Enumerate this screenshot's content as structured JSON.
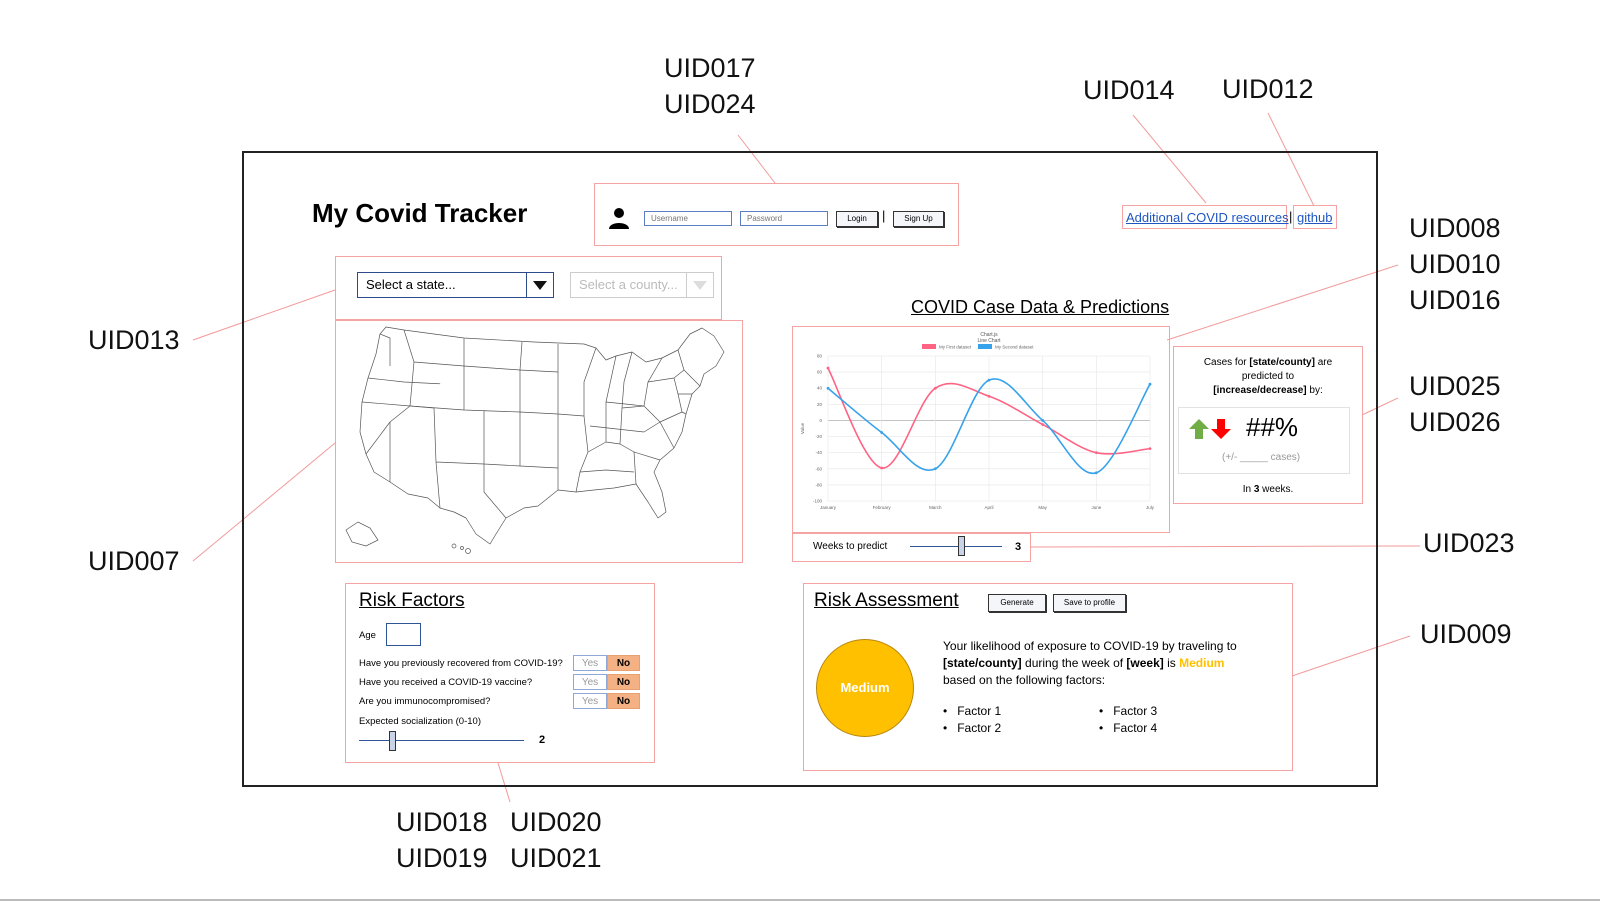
{
  "uid_labels": {
    "top_login_a": "UID017",
    "top_login_b": "UID024",
    "resources": "UID014",
    "github": "UID012",
    "chart_a": "UID008",
    "chart_b": "UID010",
    "chart_c": "UID016",
    "select": "UID013",
    "prediction_a": "UID025",
    "prediction_b": "UID026",
    "map": "UID007",
    "weeks": "UID023",
    "assessment": "UID009",
    "risk_a": "UID018",
    "risk_b": "UID020",
    "risk_c": "UID019",
    "risk_d": "UID021"
  },
  "header": {
    "title": "My Covid Tracker",
    "username_placeholder": "Username",
    "password_placeholder": "Password",
    "login_label": "Login",
    "separator": "|",
    "signup_label": "Sign Up",
    "resources_link": "Additional COVID resources",
    "github_link": "github",
    "user_icon": "user-icon"
  },
  "location": {
    "state_select": "Select a state...",
    "county_select": "Select a county..."
  },
  "chart": {
    "heading": "COVID Case Data & Predictions",
    "weeks_label": "Weeks to predict",
    "weeks_value": "3",
    "weeks_fraction": 0.55
  },
  "chart_data": {
    "type": "line",
    "title": "Chart.js Line Chart",
    "xlabel": "",
    "ylabel": "Value",
    "categories": [
      "January",
      "February",
      "March",
      "April",
      "May",
      "June",
      "July"
    ],
    "ylim": [
      -100,
      80
    ],
    "yticks": [
      80,
      60,
      40,
      20,
      0,
      -20,
      -40,
      -60,
      -80,
      -100
    ],
    "legend_position": "top",
    "grid": true,
    "series": [
      {
        "name": "My First dataset",
        "color": "#ff6384",
        "values": [
          65,
          -59,
          40,
          30,
          -5,
          -40,
          -35
        ]
      },
      {
        "name": "My Second dataset",
        "color": "#36a2eb",
        "values": [
          40,
          -15,
          -60,
          50,
          0,
          -65,
          45
        ]
      }
    ]
  },
  "prediction": {
    "line1_pre": "Cases for ",
    "line1_bold": "[state/county]",
    "line1_post": " are",
    "line2": "predicted to",
    "line3_bold": "[increase/decrease]",
    "line3_post": " by:",
    "percent": "##%",
    "cases": "(+/- _____ cases)",
    "weeks_pre": "In ",
    "weeks_bold": "3",
    "weeks_post": " weeks.",
    "up_color": "#70ad47",
    "down_color": "#ff0000"
  },
  "risk_factors": {
    "heading": "Risk Factors",
    "age_label": "Age",
    "questions": [
      {
        "text": "Have you previously recovered from COVID-19?",
        "yes": "Yes",
        "no": "No"
      },
      {
        "text": "Have you received a COVID-19 vaccine?",
        "yes": "Yes",
        "no": "No"
      },
      {
        "text": "Are you immunocompromised?",
        "yes": "Yes",
        "no": "No"
      }
    ],
    "socialization_label": "Expected socialization (0-10)",
    "socialization_value": "2",
    "socialization_fraction": 0.2
  },
  "risk_assessment": {
    "heading": "Risk Assessment",
    "generate_label": "Generate",
    "save_label": "Save to profile",
    "level": "Medium",
    "level_color": "#ffc000",
    "text_line1": "Your likelihood of exposure to COVID-19 by traveling to",
    "text_line2_bold_a": "[state/county]",
    "text_line2_mid": " during the week of ",
    "text_line2_bold_b": "[week]",
    "text_line2_is": " is ",
    "text_line2_level": "Medium",
    "text_line3": "based on the following factors:",
    "factors": [
      "Factor 1",
      "Factor 2",
      "Factor 3",
      "Factor 4"
    ]
  }
}
